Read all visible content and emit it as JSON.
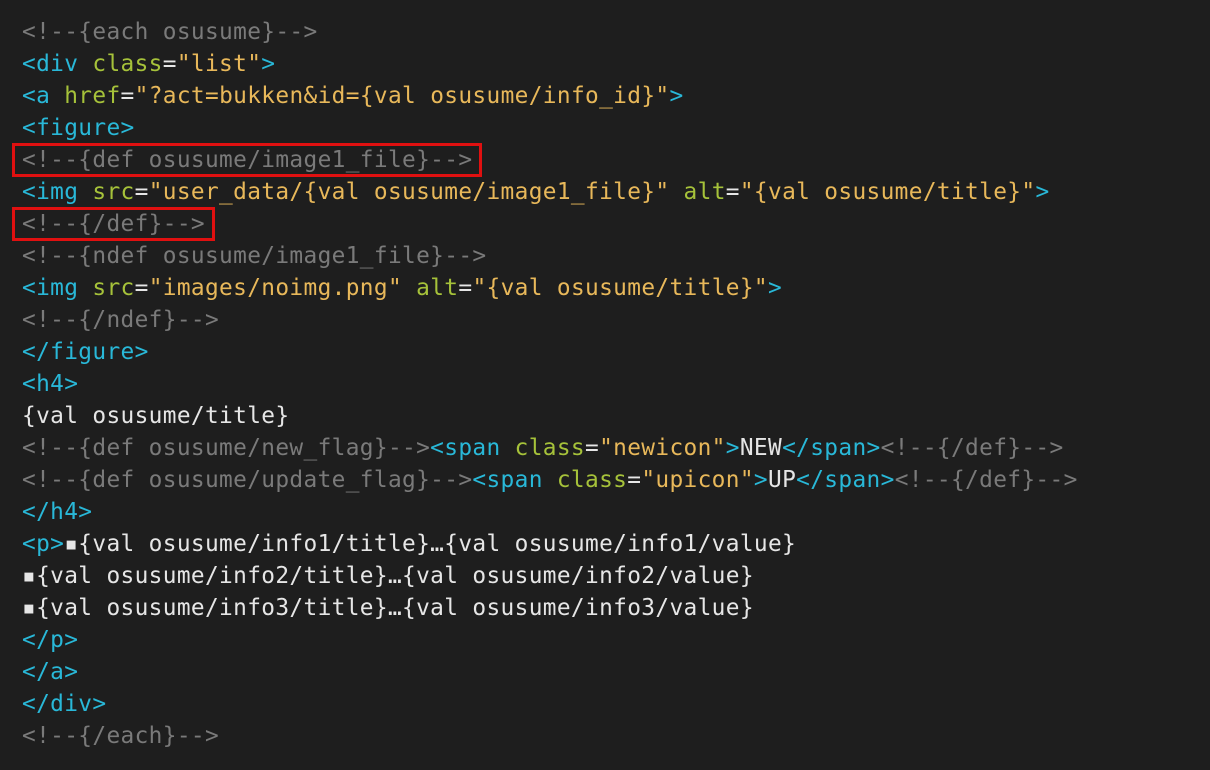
{
  "colors": {
    "background": "#1e1e1e",
    "tag": "#29b8d8",
    "attr": "#a6c23a",
    "string": "#e8b85a",
    "plain": "#e6e6e6",
    "punct": "#e6e6e6",
    "comment": "#7a7a7a",
    "highlight_box": "#e01010"
  },
  "highlighted_lines": [
    4,
    6
  ],
  "lines": [
    [
      {
        "t": "c",
        "v": "<!--{each osusume}-->"
      }
    ],
    [
      {
        "t": "tag",
        "v": "<div "
      },
      {
        "t": "attr",
        "v": "class"
      },
      {
        "t": "p",
        "v": "="
      },
      {
        "t": "str",
        "v": "\"list\""
      },
      {
        "t": "tag",
        "v": ">"
      }
    ],
    [
      {
        "t": "tag",
        "v": "<a "
      },
      {
        "t": "attr",
        "v": "href"
      },
      {
        "t": "p",
        "v": "="
      },
      {
        "t": "str",
        "v": "\"?act=bukken&id={val osusume/info_id}\""
      },
      {
        "t": "tag",
        "v": ">"
      }
    ],
    [
      {
        "t": "tag",
        "v": "<figure>"
      }
    ],
    [
      {
        "t": "c",
        "v": "<!--{def osusume/image1_file}-->"
      }
    ],
    [
      {
        "t": "tag",
        "v": "<img "
      },
      {
        "t": "attr",
        "v": "src"
      },
      {
        "t": "p",
        "v": "="
      },
      {
        "t": "str",
        "v": "\"user_data/{val osusume/image1_file}\""
      },
      {
        "t": "p",
        "v": " "
      },
      {
        "t": "attr",
        "v": "alt"
      },
      {
        "t": "p",
        "v": "="
      },
      {
        "t": "str",
        "v": "\"{val osusume/title}\""
      },
      {
        "t": "tag",
        "v": ">"
      }
    ],
    [
      {
        "t": "c",
        "v": "<!--{/def}-->"
      }
    ],
    [
      {
        "t": "c",
        "v": "<!--{ndef osusume/image1_file}-->"
      }
    ],
    [
      {
        "t": "tag",
        "v": "<img "
      },
      {
        "t": "attr",
        "v": "src"
      },
      {
        "t": "p",
        "v": "="
      },
      {
        "t": "str",
        "v": "\"images/noimg.png\""
      },
      {
        "t": "p",
        "v": " "
      },
      {
        "t": "attr",
        "v": "alt"
      },
      {
        "t": "p",
        "v": "="
      },
      {
        "t": "str",
        "v": "\"{val osusume/title}\""
      },
      {
        "t": "tag",
        "v": ">"
      }
    ],
    [
      {
        "t": "c",
        "v": "<!--{/ndef}-->"
      }
    ],
    [
      {
        "t": "tag",
        "v": "</figure>"
      }
    ],
    [
      {
        "t": "tag",
        "v": "<h4>"
      }
    ],
    [
      {
        "t": "txt",
        "v": "{val osusume/title}"
      }
    ],
    [
      {
        "t": "c",
        "v": "<!--{def osusume/new_flag}-->"
      },
      {
        "t": "tag",
        "v": "<span "
      },
      {
        "t": "attr",
        "v": "class"
      },
      {
        "t": "p",
        "v": "="
      },
      {
        "t": "str",
        "v": "\"newicon\""
      },
      {
        "t": "tag",
        "v": ">"
      },
      {
        "t": "txt",
        "v": "NEW"
      },
      {
        "t": "tag",
        "v": "</span>"
      },
      {
        "t": "c",
        "v": "<!--{/def}-->"
      }
    ],
    [
      {
        "t": "c",
        "v": "<!--{def osusume/update_flag}-->"
      },
      {
        "t": "tag",
        "v": "<span "
      },
      {
        "t": "attr",
        "v": "class"
      },
      {
        "t": "p",
        "v": "="
      },
      {
        "t": "str",
        "v": "\"upicon\""
      },
      {
        "t": "tag",
        "v": ">"
      },
      {
        "t": "txt",
        "v": "UP"
      },
      {
        "t": "tag",
        "v": "</span>"
      },
      {
        "t": "c",
        "v": "<!--{/def}-->"
      }
    ],
    [
      {
        "t": "tag",
        "v": "</h4>"
      }
    ],
    [
      {
        "t": "tag",
        "v": "<p>"
      },
      {
        "t": "txt",
        "v": "▪{val osusume/info1/title}…{val osusume/info1/value}"
      }
    ],
    [
      {
        "t": "txt",
        "v": "▪{val osusume/info2/title}…{val osusume/info2/value}"
      }
    ],
    [
      {
        "t": "txt",
        "v": "▪{val osusume/info3/title}…{val osusume/info3/value}"
      }
    ],
    [
      {
        "t": "tag",
        "v": "</p>"
      }
    ],
    [
      {
        "t": "tag",
        "v": "</a>"
      }
    ],
    [
      {
        "t": "tag",
        "v": "</div>"
      }
    ],
    [
      {
        "t": "c",
        "v": "<!--{/each}-->"
      }
    ]
  ]
}
